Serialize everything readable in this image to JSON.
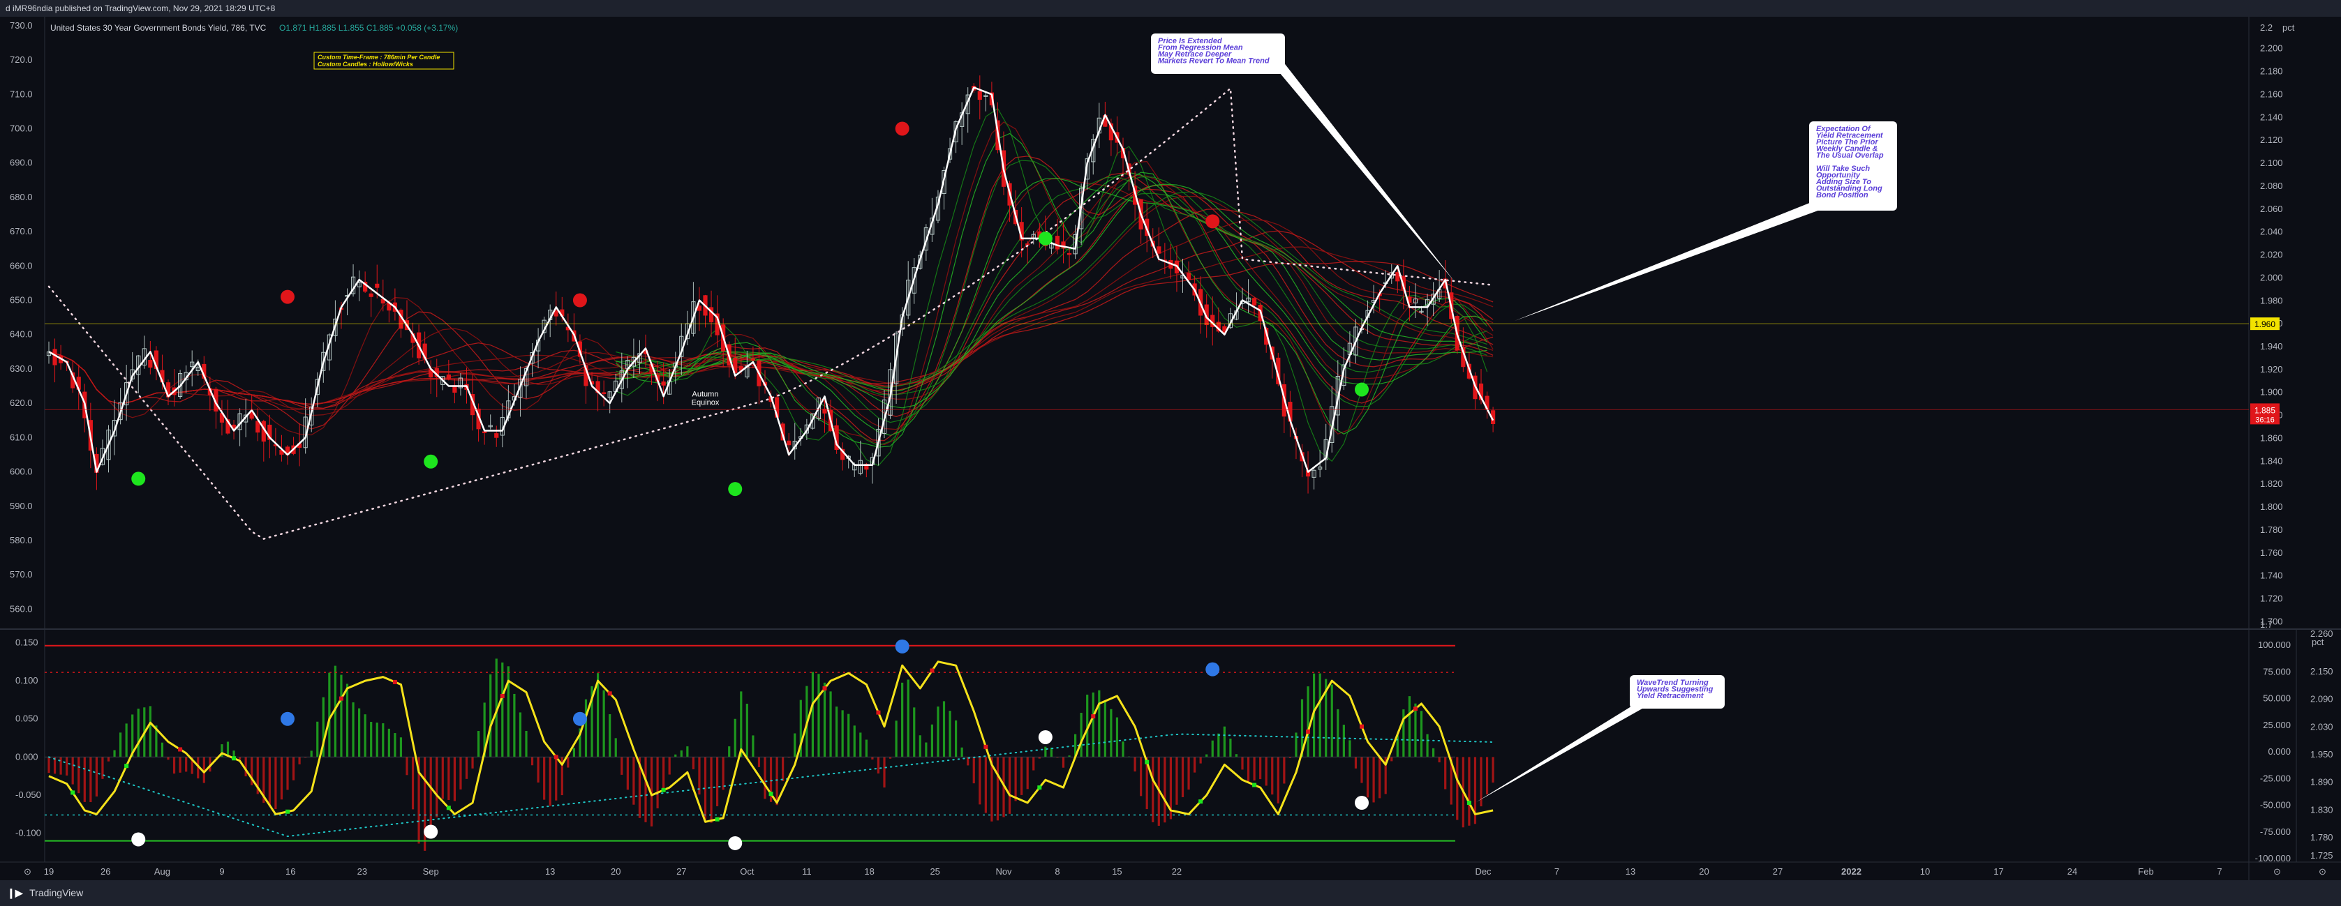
{
  "topbar": {
    "publish_text": "d iMR96ndia published on TradingView.com, Nov 29, 2021 18:29 UTC+8"
  },
  "footer": {
    "brand": "TradingView"
  },
  "chart_data": [
    {
      "type": "candlestick",
      "title": "United States 30 Year Government Bonds Yield, 786, TVC",
      "ohlc": {
        "o": "O1.871",
        "h": "H1.885",
        "l": "L1.855",
        "c": "C1.885",
        "chg": "+0.058 (+3.17%)"
      },
      "box_label": [
        "Custom Time-Frame : 786min Per Candle",
        "Custom Candles : Hollow/Wicks"
      ],
      "left_axis": {
        "ylim": [
          555,
          732
        ],
        "ticks": [
          "730.0",
          "720.0",
          "710.0",
          "700.0",
          "690.0",
          "680.0",
          "670.0",
          "660.0",
          "650.0",
          "640.0",
          "630.0",
          "620.0",
          "610.0",
          "600.0",
          "590.0",
          "580.0",
          "570.0",
          "560.0"
        ]
      },
      "right_axis": {
        "ylim": [
          1.696,
          2.226
        ],
        "ticks": [
          "2.200",
          "2.180",
          "2.160",
          "2.140",
          "2.120",
          "2.100",
          "2.080",
          "2.060",
          "2.040",
          "2.020",
          "2.000",
          "1.980",
          "1.960",
          "1.940",
          "1.920",
          "1.900",
          "1.880",
          "1.860",
          "1.840",
          "1.820",
          "1.800",
          "1.780",
          "1.760",
          "1.740",
          "1.720",
          "1.700"
        ],
        "corner_ticks": [
          "2.2",
          "1.7"
        ],
        "tag_top": "pct"
      },
      "price_labels": [
        {
          "value": 1.96,
          "text": "1.960",
          "color": "#f2e200"
        },
        {
          "value": 1.885,
          "text": "1.885",
          "sub": "36:16",
          "color": "#e0161a"
        }
      ],
      "x_ticks": [
        "19",
        "26",
        "Aug",
        "9",
        "16",
        "23",
        "Sep",
        "13",
        "20",
        "27",
        "Oct",
        "11",
        "18",
        "25",
        "Nov",
        "8",
        "15",
        "22",
        "Dec",
        "7",
        "13",
        "20",
        "27",
        "2022",
        "10",
        "17",
        "24",
        "Feb",
        "7"
      ],
      "close_path": [
        [
          0,
          635
        ],
        [
          3,
          632
        ],
        [
          6,
          620
        ],
        [
          8,
          600
        ],
        [
          11,
          612
        ],
        [
          14,
          628
        ],
        [
          17,
          635
        ],
        [
          20,
          622
        ],
        [
          22,
          625
        ],
        [
          25,
          632
        ],
        [
          28,
          620
        ],
        [
          31,
          612
        ],
        [
          34,
          618
        ],
        [
          37,
          610
        ],
        [
          40,
          605
        ],
        [
          43,
          610
        ],
        [
          46,
          632
        ],
        [
          49,
          648
        ],
        [
          52,
          656
        ],
        [
          55,
          652
        ],
        [
          58,
          648
        ],
        [
          61,
          640
        ],
        [
          64,
          630
        ],
        [
          67,
          625
        ],
        [
          70,
          625
        ],
        [
          73,
          612
        ],
        [
          76,
          612
        ],
        [
          79,
          625
        ],
        [
          82,
          638
        ],
        [
          85,
          648
        ],
        [
          88,
          640
        ],
        [
          91,
          625
        ],
        [
          94,
          620
        ],
        [
          97,
          630
        ],
        [
          100,
          636
        ],
        [
          103,
          622
        ],
        [
          106,
          635
        ],
        [
          109,
          650
        ],
        [
          112,
          645
        ],
        [
          115,
          628
        ],
        [
          118,
          632
        ],
        [
          121,
          622
        ],
        [
          124,
          605
        ],
        [
          127,
          612
        ],
        [
          130,
          622
        ],
        [
          132,
          608
        ],
        [
          135,
          602
        ],
        [
          138,
          602
        ],
        [
          141,
          622
        ],
        [
          143,
          645
        ],
        [
          146,
          662
        ],
        [
          149,
          678
        ],
        [
          152,
          700
        ],
        [
          155,
          712
        ],
        [
          158,
          710
        ],
        [
          160,
          688
        ],
        [
          163,
          668
        ],
        [
          166,
          668
        ],
        [
          169,
          666
        ],
        [
          172,
          665
        ],
        [
          174,
          690
        ],
        [
          177,
          704
        ],
        [
          180,
          694
        ],
        [
          183,
          675
        ],
        [
          186,
          662
        ],
        [
          189,
          660
        ],
        [
          192,
          653
        ],
        [
          194,
          645
        ],
        [
          197,
          640
        ],
        [
          200,
          650
        ],
        [
          203,
          647
        ],
        [
          206,
          628
        ],
        [
          208,
          615
        ],
        [
          211,
          600
        ],
        [
          214,
          604
        ],
        [
          217,
          630
        ],
        [
          220,
          642
        ],
        [
          223,
          652
        ],
        [
          226,
          660
        ],
        [
          228,
          648
        ],
        [
          231,
          648
        ],
        [
          234,
          656
        ],
        [
          236,
          640
        ],
        [
          239,
          625
        ],
        [
          242,
          615
        ]
      ],
      "pattern_labels": [
        "Autumn",
        "Equinox"
      ],
      "markers": [
        {
          "color": "#e0161a",
          "x": 40,
          "y": 651
        },
        {
          "color": "#e0161a",
          "x": 89,
          "y": 650
        },
        {
          "color": "#e0161a",
          "x": 143,
          "y": 700
        },
        {
          "color": "#e0161a",
          "x": 195,
          "y": 673
        },
        {
          "color": "#1ee51e",
          "x": 15,
          "y": 598
        },
        {
          "color": "#1ee51e",
          "x": 64,
          "y": 603
        },
        {
          "color": "#1ee51e",
          "x": 115,
          "y": 595
        },
        {
          "color": "#1ee51e",
          "x": 167,
          "y": 668
        },
        {
          "color": "#1ee51e",
          "x": 220,
          "y": 624
        }
      ],
      "annotations": [
        {
          "lines": [
            "Price Is Extended",
            "From Regression Mean",
            "May Retrace Deeper",
            "Markets Revert To Mean Trend"
          ]
        },
        {
          "lines": [
            "Expectation Of",
            "Yield Retracement",
            "Picture The Prior",
            "Weekly Candle &",
            "The Usual Overlap",
            "",
            "Will Take Such",
            "Opportunity",
            "Adding Size To",
            "Outstanding Long",
            "Bond Position"
          ]
        }
      ]
    },
    {
      "type": "oscillator",
      "left_axis": {
        "ylim": [
          -0.135,
          0.165
        ],
        "ticks": [
          "0.150",
          "0.100",
          "0.050",
          "0.000",
          "-0.050",
          "-0.100"
        ]
      },
      "right_axis": {
        "ticks": [
          "100.000",
          "75.000",
          "50.000",
          "25.000",
          "0.000",
          "-25.000",
          "-50.000",
          "-75.000",
          "-100.000"
        ]
      },
      "far_right_axis": {
        "ticks": [
          "2.150",
          "2.090",
          "2.030",
          "1.950",
          "1.890",
          "1.830",
          "1.780"
        ],
        "corner_ticks": [
          "2.260",
          "1.725"
        ],
        "tag_top": "pct"
      },
      "levels": {
        "upper_solid": 0.146,
        "upper_dotted": 0.111,
        "lower_dotted": -0.076,
        "lower_solid": -0.11
      },
      "wave_path": [
        [
          0,
          -0.025
        ],
        [
          3,
          -0.035
        ],
        [
          6,
          -0.07
        ],
        [
          8,
          -0.075
        ],
        [
          11,
          -0.045
        ],
        [
          14,
          0.005
        ],
        [
          17,
          0.045
        ],
        [
          20,
          0.02
        ],
        [
          23,
          0.005
        ],
        [
          26,
          -0.02
        ],
        [
          29,
          0.005
        ],
        [
          32,
          -0.005
        ],
        [
          35,
          -0.04
        ],
        [
          38,
          -0.075
        ],
        [
          41,
          -0.07
        ],
        [
          44,
          -0.045
        ],
        [
          47,
          0.05
        ],
        [
          50,
          0.09
        ],
        [
          53,
          0.1
        ],
        [
          56,
          0.105
        ],
        [
          59,
          0.095
        ],
        [
          62,
          -0.02
        ],
        [
          65,
          -0.05
        ],
        [
          68,
          -0.075
        ],
        [
          71,
          -0.06
        ],
        [
          74,
          0.04
        ],
        [
          77,
          0.1
        ],
        [
          80,
          0.085
        ],
        [
          83,
          0.02
        ],
        [
          86,
          -0.01
        ],
        [
          89,
          0.03
        ],
        [
          92,
          0.1
        ],
        [
          95,
          0.075
        ],
        [
          98,
          0.01
        ],
        [
          101,
          -0.05
        ],
        [
          104,
          -0.04
        ],
        [
          107,
          -0.02
        ],
        [
          110,
          -0.085
        ],
        [
          113,
          -0.08
        ],
        [
          116,
          0.01
        ],
        [
          119,
          -0.025
        ],
        [
          122,
          -0.06
        ],
        [
          125,
          -0.01
        ],
        [
          128,
          0.07
        ],
        [
          131,
          0.1
        ],
        [
          134,
          0.11
        ],
        [
          137,
          0.095
        ],
        [
          140,
          0.04
        ],
        [
          143,
          0.12
        ],
        [
          146,
          0.09
        ],
        [
          149,
          0.125
        ],
        [
          152,
          0.12
        ],
        [
          155,
          0.06
        ],
        [
          158,
          -0.01
        ],
        [
          161,
          -0.05
        ],
        [
          164,
          -0.06
        ],
        [
          167,
          -0.03
        ],
        [
          170,
          -0.04
        ],
        [
          173,
          0.02
        ],
        [
          176,
          0.07
        ],
        [
          179,
          0.08
        ],
        [
          182,
          0.04
        ],
        [
          185,
          -0.03
        ],
        [
          188,
          -0.07
        ],
        [
          191,
          -0.075
        ],
        [
          194,
          -0.05
        ],
        [
          197,
          -0.01
        ],
        [
          200,
          -0.03
        ],
        [
          203,
          -0.04
        ],
        [
          206,
          -0.075
        ],
        [
          209,
          -0.02
        ],
        [
          212,
          0.06
        ],
        [
          215,
          0.1
        ],
        [
          218,
          0.08
        ],
        [
          221,
          0.02
        ],
        [
          224,
          -0.01
        ],
        [
          227,
          0.05
        ],
        [
          230,
          0.07
        ],
        [
          233,
          0.04
        ],
        [
          236,
          -0.03
        ],
        [
          239,
          -0.075
        ],
        [
          242,
          -0.07
        ]
      ],
      "markers": [
        {
          "color": "#2f78e6",
          "x": 40,
          "y": 0.05
        },
        {
          "color": "#2f78e6",
          "x": 89,
          "y": 0.05
        },
        {
          "color": "#2f78e6",
          "x": 143,
          "y": 0.145
        },
        {
          "color": "#2f78e6",
          "x": 195,
          "y": 0.115
        },
        {
          "color": "#ffffff",
          "x": 15,
          "y": -0.108
        },
        {
          "color": "#ffffff",
          "x": 64,
          "y": -0.098
        },
        {
          "color": "#ffffff",
          "x": 115,
          "y": -0.113
        },
        {
          "color": "#ffffff",
          "x": 167,
          "y": 0.026
        },
        {
          "color": "#ffffff",
          "x": 220,
          "y": -0.06
        }
      ],
      "annotation": {
        "lines": [
          "WaveTrend Turning",
          "Upwards Suggesting",
          "Yield Retracement"
        ]
      }
    }
  ]
}
